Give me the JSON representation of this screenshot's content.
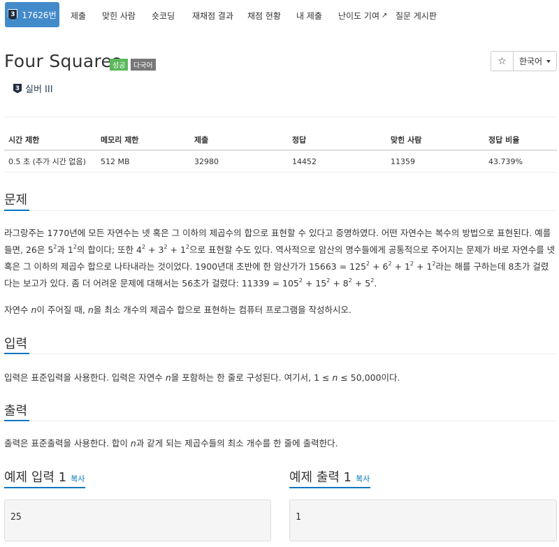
{
  "nav": {
    "problem_id": "17626번",
    "tier_number": "3",
    "items": [
      "제출",
      "맞힌 사람",
      "숏코딩",
      "재채점 결과",
      "채점 현황",
      "내 제출",
      "난이도 기여",
      "질문 게시판"
    ]
  },
  "problem": {
    "title": "Four Squares",
    "label_success": "성공",
    "label_lang": "다국어",
    "star_icon": "☆",
    "language_select": "한국어",
    "tier_badge": "3",
    "tier_name": "실버 III"
  },
  "stats": {
    "headers": [
      "시간 제한",
      "메모리 제한",
      "제출",
      "정답",
      "맞힌 사람",
      "정답 비율"
    ],
    "values": [
      "0.5 초 (추가 시간 없음)",
      "512 MB",
      "32980",
      "14452",
      "11359",
      "43.739%"
    ]
  },
  "sections": {
    "problem_heading": "문제",
    "problem_p1_parts": [
      "라그랑주는 1770년에 모든 자연수는 넷 혹은 그 이하의 제곱수의 합으로 표현할 수 있다고 증명하였다. 어떤 자연수는 복수의 방법으로 표현된다. 예를 들면, 26은 5",
      "2",
      "과 1",
      "2",
      "의 합이다; 또한 4",
      "2",
      " + 3",
      "2",
      " + 1",
      "2",
      "으로 표현할 수도 있다. 역사적으로 암산의 명수들에게 공통적으로 주어지는 문제가 바로 자연수를 넷 혹은 그 이하의 제곱수 합으로 나타내라는 것이었다. 1900년대 초반에 한 암산가가 15663 = 125",
      "2",
      " + 6",
      "2",
      " + 1",
      "2",
      " + 1",
      "2",
      "라는 해를 구하는데 8초가 걸렸다는 보고가 있다. 좀 더 어려운 문제에 대해서는 56초가 걸렸다: 11339 = 105",
      "2",
      " + 15",
      "2",
      " + 8",
      "2",
      " + 5",
      "2",
      "."
    ],
    "problem_p2_parts": [
      "자연수 ",
      "n",
      "이 주어질 때, ",
      "n",
      "을 최소 개수의 제곱수 합으로 표현하는 컴퓨터 프로그램을 작성하시오."
    ],
    "input_heading": "입력",
    "input_parts": [
      "입력은 표준입력을 사용한다. 입력은 자연수 ",
      "n",
      "을 포함하는 한 줄로 구성된다. 여기서, 1 ≤ ",
      "n",
      " ≤ 50,000이다."
    ],
    "output_heading": "출력",
    "output_parts": [
      "출력은 표준출력을 사용한다. 합이 ",
      "n",
      "과 같게 되는 제곱수들의 최소 개수를 한 줄에 출력한다."
    ],
    "sample_input_heading": "예제 입력 1",
    "sample_output_heading": "예제 출력 1",
    "copy_label": "복사",
    "sample_input": "25",
    "sample_output": "1"
  },
  "colors": {
    "nav_active": "#428bca",
    "success": "#5cb85c",
    "lang_label": "#777777",
    "link": "#0076c0"
  }
}
